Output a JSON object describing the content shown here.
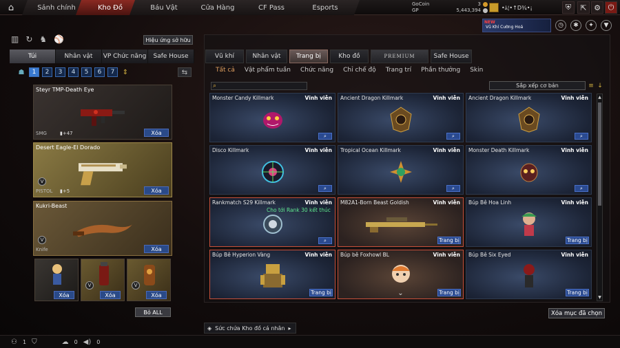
{
  "topnav": {
    "tabs": [
      "Sảnh chính",
      "Kho Đồ",
      "Báu Vật",
      "Cửa Hàng",
      "CF Pass",
      "Esports"
    ],
    "active_index": 1,
    "currency": {
      "gocoin_label": "GoCoin",
      "gocoin_value": "3",
      "gp_label": "GP",
      "gp_value": "5,443,394"
    },
    "player_name": "•ﾑ¦•↑D¾•¡"
  },
  "event_strip": {
    "new_label": "NEW",
    "weapon_label": "Vũ Khí Cường Hoá"
  },
  "left": {
    "hieu_ung_label": "Hiệu ứng sở hữu",
    "tabs": [
      "Túi",
      "Nhân vật",
      "VP Chức năng",
      "Safe House"
    ],
    "pages": [
      "1",
      "2",
      "3",
      "4",
      "5",
      "6",
      "7"
    ],
    "weapons": [
      {
        "name": "Steyr TMP-Death Eye",
        "type": "SMG",
        "extra": "▮+47",
        "xoa": "Xóa"
      },
      {
        "name": "Desert Eagle-El Dorado",
        "type": "PISTOL",
        "extra": "▮+5",
        "xoa": "Xóa"
      },
      {
        "name": "Kukri-Beast",
        "type": "Knife",
        "extra": "",
        "xoa": "Xóa"
      }
    ],
    "small_xoa": "Xóa",
    "bo_all": "Bỏ ALL"
  },
  "right": {
    "tabs": [
      "Vũ khí",
      "Nhân vật",
      "Trang bị",
      "Kho đồ",
      "PREMIUM",
      "Safe House"
    ],
    "active_tab": 2,
    "subtabs": [
      "Tất cả",
      "Vật phẩm tuần",
      "Chức năng",
      "Chỉ chế độ",
      "Trang trí",
      "Phần thưởng",
      "Skin"
    ],
    "sort_label": "Sắp xếp cơ bản",
    "permanent": "Vĩnh viễn",
    "equip_label": "Trang bị",
    "items": [
      {
        "name": "Monster Candy Killmark",
        "action": "mag"
      },
      {
        "name": "Ancient Dragon Killmark",
        "action": "mag"
      },
      {
        "name": "Ancient Dragon Killmark",
        "action": "mag"
      },
      {
        "name": "Disco Killmark",
        "action": "mag"
      },
      {
        "name": "Tropical Ocean Killmark",
        "action": "mag"
      },
      {
        "name": "Monster Death Killmark",
        "action": "mag"
      },
      {
        "name": "Rankmatch S29 Killmark",
        "action": "mag",
        "note": "Cho tới Rank 30 kết thúc"
      },
      {
        "name": "M82A1-Born Beast Goldish",
        "action": "equip"
      },
      {
        "name": "Búp Bê Hoa Linh",
        "action": "equip"
      },
      {
        "name": "Búp Bê Hyperion Vàng",
        "action": "equip"
      },
      {
        "name": "Búp bê Foxhowl BL",
        "action": "equip"
      },
      {
        "name": "Búp Bê Six Eyed",
        "action": "equip"
      }
    ],
    "clear_label": "Xóa mục đã chọn",
    "repair_label": "Sức chứa Kho đồ cá nhân"
  },
  "status": {
    "players": "1",
    "messages": "0",
    "voice": "0"
  }
}
